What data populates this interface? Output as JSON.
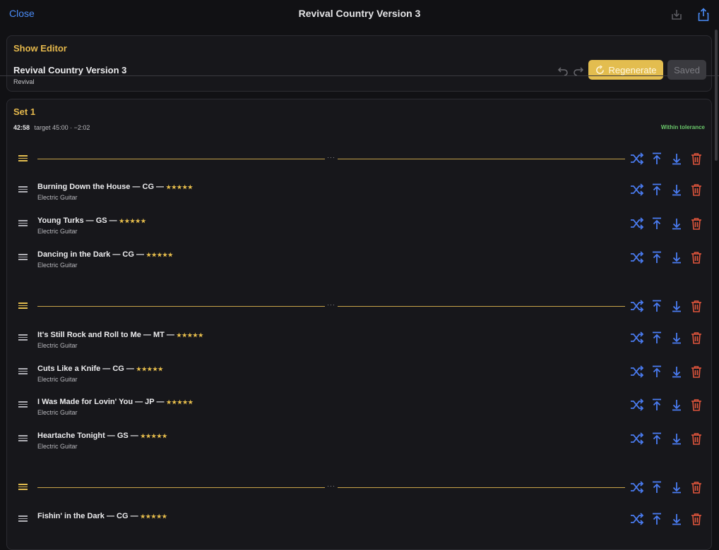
{
  "topbar": {
    "close_label": "Close",
    "title": "Revival Country Version 3",
    "icons": [
      "download-icon",
      "share-icon"
    ]
  },
  "editor": {
    "heading": "Show Editor",
    "show_name": "Revival Country Version 3",
    "show_subtitle": "Revival",
    "regenerate_label": "Regenerate",
    "saved_label": "Saved"
  },
  "set": {
    "heading": "Set 1",
    "duration": "42:58",
    "target_text": "target 45:00 · −2:02",
    "tolerance_text": "Within tolerance",
    "rows": [
      {
        "kind": "separator"
      },
      {
        "kind": "song",
        "title": "Burning Down the House — CG —",
        "instrument": "Electric Guitar"
      },
      {
        "kind": "song",
        "title": "Young Turks — GS —",
        "instrument": "Electric Guitar"
      },
      {
        "kind": "song",
        "title": "Dancing in the Dark — CG —",
        "instrument": "Electric Guitar"
      },
      {
        "kind": "separator"
      },
      {
        "kind": "song",
        "title": "It's Still Rock and Roll to Me — MT —",
        "instrument": "Electric Guitar"
      },
      {
        "kind": "song",
        "title": "Cuts Like a Knife — CG —",
        "instrument": "Electric Guitar"
      },
      {
        "kind": "song",
        "title": "I Was Made for Lovin' You — JP —",
        "instrument": "Electric Guitar"
      },
      {
        "kind": "song",
        "title": "Heartache Tonight — GS —",
        "instrument": "Electric Guitar"
      },
      {
        "kind": "separator"
      },
      {
        "kind": "song",
        "title": "Fishin' in the Dark — CG —",
        "instrument": ""
      }
    ],
    "rating_stars": "★★★★★",
    "separator_dots": "···"
  },
  "colors": {
    "accent": "#e3bd4f",
    "action_blue": "#4a7cf2",
    "delete_red": "#e0553c",
    "ok_green": "#6ac86a",
    "background": "#111114"
  }
}
